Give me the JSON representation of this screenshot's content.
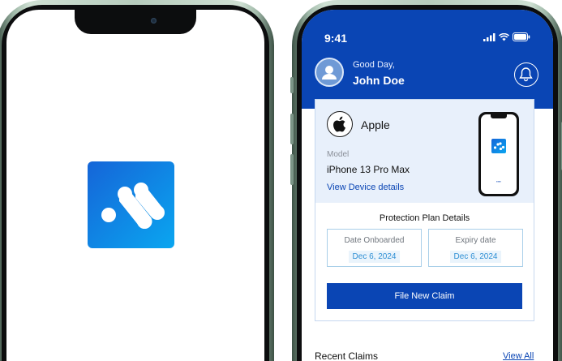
{
  "status_bar": {
    "time": "9:41"
  },
  "header": {
    "greeting": "Good Day,",
    "user_name": "John Doe"
  },
  "device": {
    "brand": "Apple",
    "model_label": "Model",
    "model_value": "iPhone 13 Pro Max",
    "view_details_link": "View Device details"
  },
  "protection_plan": {
    "title": "Protection Plan Details",
    "onboarded_label": "Date Onboarded",
    "onboarded_value": "Dec 6, 2024",
    "expiry_label": "Expiry date",
    "expiry_value": "Dec 6, 2024"
  },
  "actions": {
    "file_claim": "File New Claim"
  },
  "recent_claims": {
    "title": "Recent Claims",
    "view_all": "View All"
  },
  "colors": {
    "brand_blue": "#0a45b4",
    "logo_gradient_start": "#1565d8",
    "logo_gradient_end": "#0aa6f0"
  },
  "icons": [
    "app-logo-icon",
    "signal-icon",
    "wifi-icon",
    "battery-icon",
    "user-avatar-icon",
    "bell-icon",
    "apple-logo-icon"
  ]
}
